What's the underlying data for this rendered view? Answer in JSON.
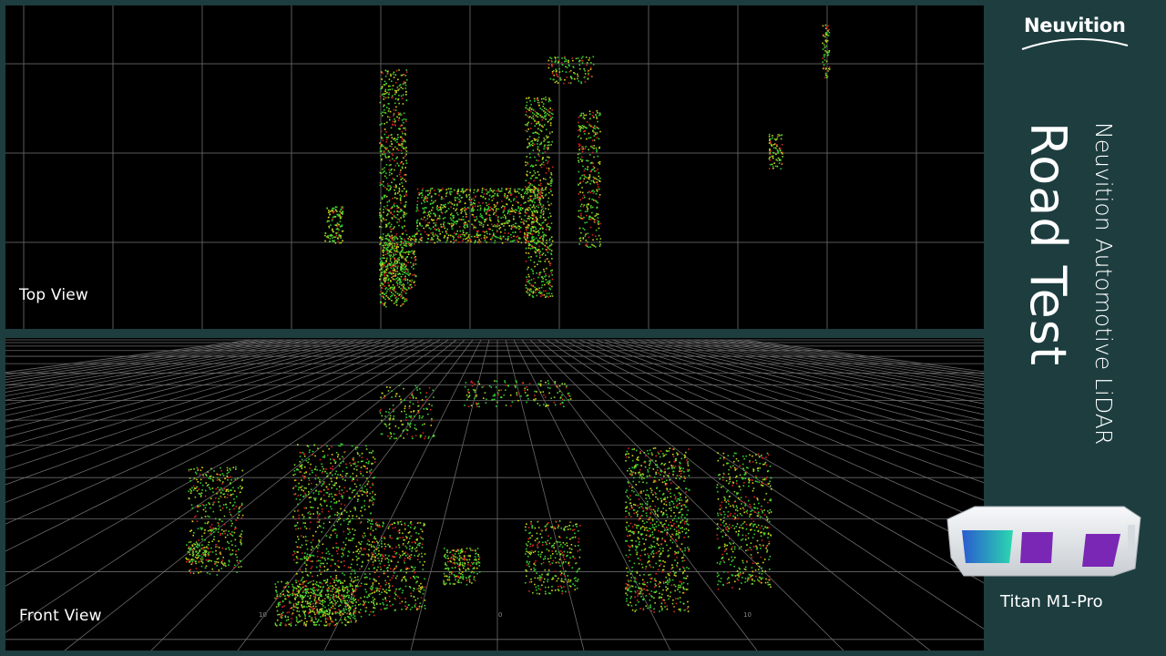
{
  "views": {
    "top_label": "Top View",
    "front_label": "Front View"
  },
  "front_ticks": [
    "10",
    "0",
    "10"
  ],
  "sidebar": {
    "brand": "Neuvition",
    "title": "Road Test",
    "subtitle": "Neuvition Automotive LiDAR",
    "model": "Titan M1-Pro"
  },
  "colors": {
    "background": "#1d3d3f",
    "grid": "#9a9a9a",
    "point_green": "#33cc33",
    "point_yellow": "#d4d41a",
    "point_red": "#d42222",
    "device_body": "#e8ecef",
    "device_lens": "#7a27b5"
  },
  "icons": {
    "logo": "neuvition-logo-icon",
    "device": "lidar-device-icon"
  }
}
